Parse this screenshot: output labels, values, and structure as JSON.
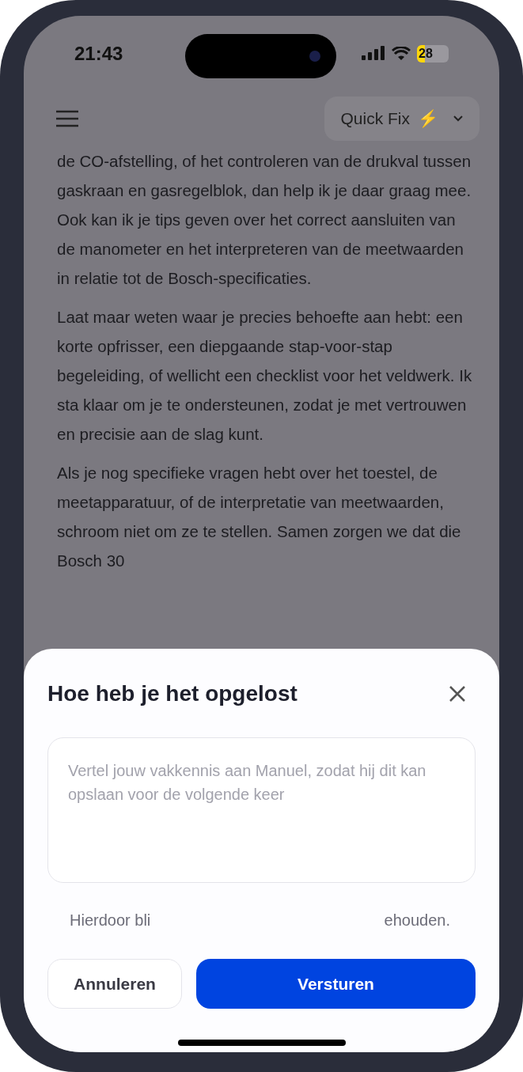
{
  "status_bar": {
    "time": "21:43",
    "battery": "28"
  },
  "header": {
    "mode_selector": {
      "label": "Quick Fix",
      "emoji": "⚡"
    }
  },
  "chat": {
    "paragraphs": [
      "de CO-afstelling, of het controleren van de drukval tussen gaskraan en gasregelblok, dan help ik je daar graag mee. Ook kan ik je tips geven over het correct aansluiten van de manometer en het interpreteren van de meetwaarden in relatie tot de Bosch-specificaties.",
      "Laat maar weten waar je precies behoefte aan hebt: een korte opfrisser, een diepgaande stap-voor-stap begeleiding, of wellicht een checklist voor het veldwerk. Ik sta klaar om je te ondersteunen, zodat je met vertrouwen en precisie aan de slag kunt.",
      "Als je nog specifieke vragen hebt over het toestel, de meetapparatuur, of de interpretatie van meetwaarden, schroom niet om ze te stellen. Samen zorgen we dat die Bosch 30"
    ]
  },
  "sheet": {
    "title": "Hoe heb je het opgelost",
    "field": {
      "placeholder": "Vertel jouw vakkennis aan Manuel, zodat hij dit kan opslaan voor de volgende keer"
    },
    "hint": [
      "Hierdoor bli",
      "ehouden."
    ],
    "buttons": [
      {
        "label": "Annuleren",
        "kind": "secondary"
      },
      {
        "label": "Versturen",
        "kind": "primary"
      }
    ]
  }
}
